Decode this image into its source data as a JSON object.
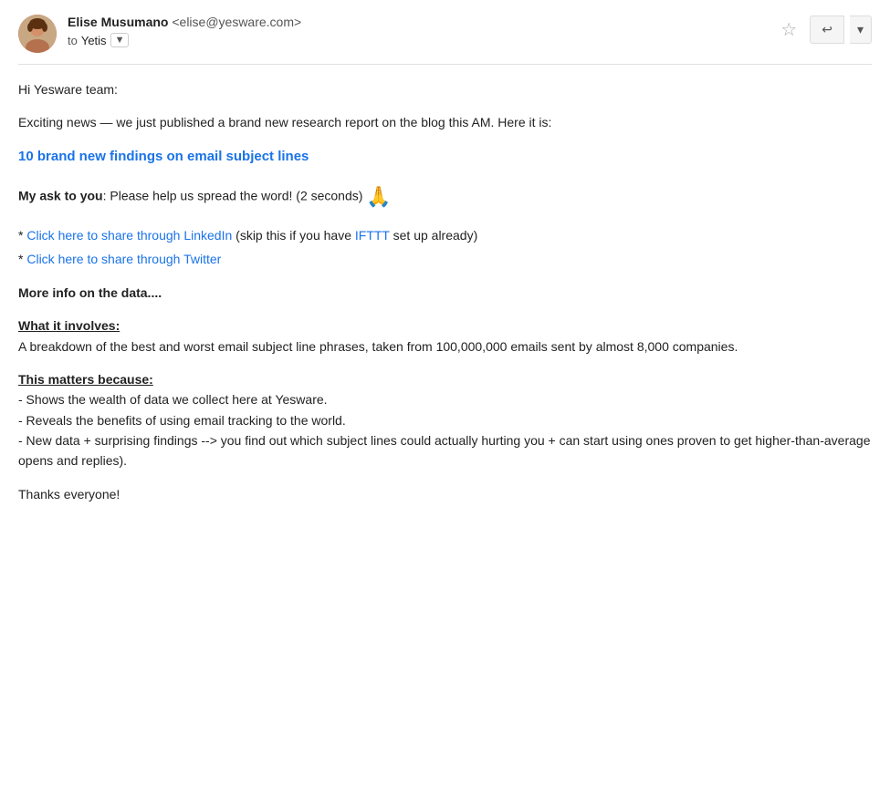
{
  "header": {
    "sender_name": "Elise Musumano",
    "sender_email": "<elise@yesware.com>",
    "to_label": "to",
    "to_recipient": "Yetis",
    "dropdown_label": "▼",
    "star_label": "☆",
    "reply_label": "↩",
    "more_label": "▾"
  },
  "body": {
    "greeting": "Hi Yesware team:",
    "intro": "Exciting news — we just published a brand new research report on the blog this AM. Here it is:",
    "main_link_text": "10 brand new findings on email subject lines",
    "ask_bold": "My ask to you",
    "ask_text": ": Please help us spread the word! (2 seconds)",
    "pray_emoji": "🙏",
    "linkedin_prefix": "* ",
    "linkedin_link": "Click here to share through LinkedIn",
    "linkedin_suffix": " (skip this if you have ",
    "ifttt_link": "IFTTT",
    "linkedin_end": " set up already)",
    "twitter_prefix": "* ",
    "twitter_link": "Click here to share through Twitter",
    "more_info_title": "More info on the data....",
    "what_it_involves_label": "What it involves:",
    "what_it_involves_text": "A breakdown of the best and worst email subject line phrases, taken from 100,000,000 emails sent by almost 8,000 companies.",
    "this_matters_label": "This matters because:",
    "bullet1": "- Shows the wealth of data we collect here at Yesware.",
    "bullet2": "- Reveals the benefits of using email tracking to the world.",
    "bullet3": "- New data + surprising findings --> you find out which subject lines could actually hurting you + can start using ones proven to get higher-than-average opens and replies).",
    "closing": "Thanks everyone!"
  },
  "colors": {
    "link": "#1a73e8",
    "text": "#222222",
    "muted": "#555555"
  }
}
